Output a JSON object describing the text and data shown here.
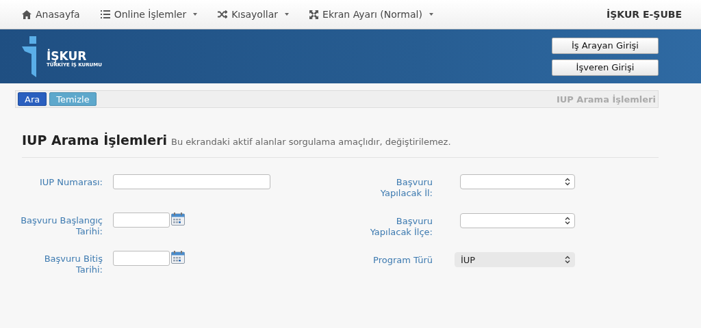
{
  "nav": {
    "items": [
      {
        "label": "Anasayfa",
        "dropdown": false
      },
      {
        "label": "Online İşlemler",
        "dropdown": true
      },
      {
        "label": "Kısayollar",
        "dropdown": true
      },
      {
        "label": "Ekran Ayarı (Normal)",
        "dropdown": true
      }
    ],
    "brand": "İŞKUR E-ŞUBE"
  },
  "header": {
    "logo_name": "İŞKUR",
    "logo_sub": "TÜRKİYE İŞ KURUMU",
    "buttons": [
      "İş Arayan Girişi",
      "İşveren Girişi"
    ]
  },
  "toolbar": {
    "buttons": [
      {
        "label": "Ara",
        "kind": "primary"
      },
      {
        "label": "Temizle",
        "kind": "secondary"
      }
    ],
    "title": "IUP Arama İşlemleri"
  },
  "page": {
    "title": "IUP Arama İşlemleri",
    "subtitle": "Bu ekrandaki aktif alanlar sorgulama amaçlıdır, değiştirilemez."
  },
  "left_fields": [
    {
      "label": "IUP Numarası:",
      "kind": "text"
    },
    {
      "label": "Başvuru Başlangıç Tarihi:",
      "kind": "date"
    },
    {
      "label": "Başvuru Bitiş Tarihi:",
      "kind": "date"
    }
  ],
  "right_fields": [
    {
      "label": "Başvuru Yapılacak İl:",
      "kind": "select",
      "disabled": false
    },
    {
      "label": "Başvuru Yapılacak İlçe:",
      "kind": "select",
      "disabled": false
    },
    {
      "label": "Program Türü",
      "kind": "select",
      "value": "İUP",
      "disabled": true
    }
  ]
}
